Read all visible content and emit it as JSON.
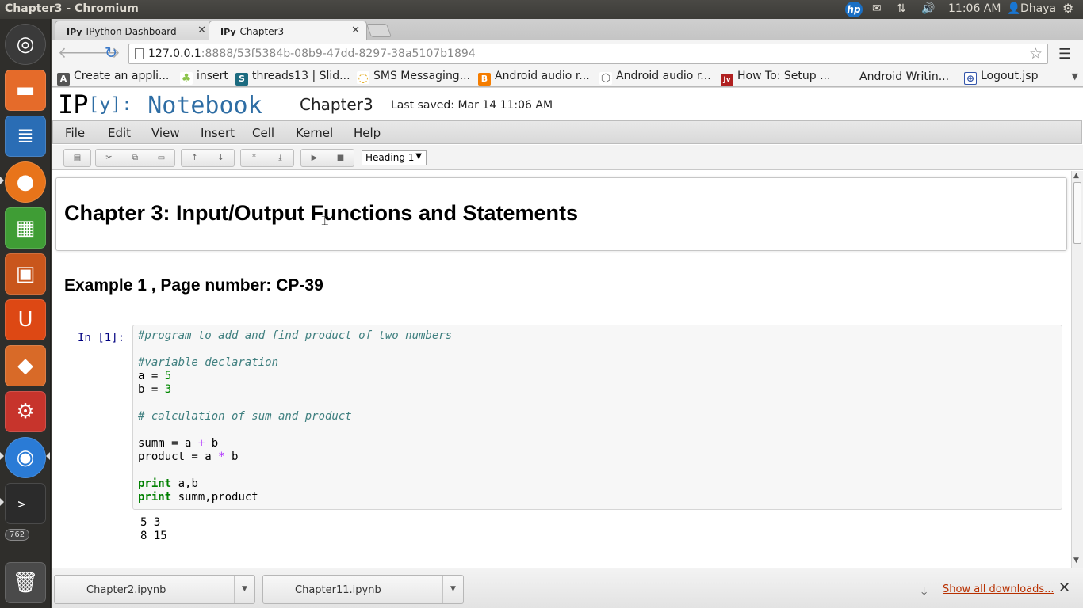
{
  "panel": {
    "window_title": "Chapter3 - Chromium",
    "time": "11:06 AM",
    "user": "Dhaya"
  },
  "launcher": {
    "badge": "762"
  },
  "tabs": [
    {
      "favicon": "IPy",
      "label": "IPython Dashboard"
    },
    {
      "favicon": "IPy",
      "label": "Chapter3"
    }
  ],
  "address": {
    "host": "127.0.0.1",
    "rest": ":8888/53f5384b-08b9-47dd-8297-38a5107b1894"
  },
  "bookmarks": [
    {
      "label": "Create an appli...",
      "color": "#555555",
      "icon": "A"
    },
    {
      "label": "insert",
      "color": "#8bc34a",
      "icon": "♣"
    },
    {
      "label": "threads13 | Slid...",
      "color": "#1c6b80",
      "icon": "S"
    },
    {
      "label": "SMS Messaging...",
      "color": "#e0a000",
      "icon": "◌"
    },
    {
      "label": "Android audio r...",
      "color": "#f57d00",
      "icon": "B"
    },
    {
      "label": "Android audio r...",
      "color": "#777777",
      "icon": "⬡"
    },
    {
      "label": "How To: Setup ...",
      "color": "#b02020",
      "icon": "Jv"
    },
    {
      "label": "Android Writin...",
      "color": "#ffffff",
      "icon": ""
    },
    {
      "label": "Logout.jsp",
      "color": "#3355aa",
      "icon": "⊕"
    }
  ],
  "ipython": {
    "logo_ip": "IP",
    "logo_y": "[y]:",
    "logo_notebook": "Notebook",
    "notebook_name": "Chapter3",
    "last_saved": "Last saved: Mar 14 11:06 AM",
    "menus": [
      "File",
      "Edit",
      "View",
      "Insert",
      "Cell",
      "Kernel",
      "Help"
    ],
    "cell_type": "Heading 1"
  },
  "cells": {
    "heading1": "Chapter 3: Input/Output Functions and Statements",
    "heading2": "Example 1 , Page number: CP-39",
    "prompt": "In [1]:",
    "code": {
      "l1": "#program to add and find product of two numbers",
      "l3": "#variable declaration",
      "l4a": "a = ",
      "l4b": "5",
      "l5a": "b = ",
      "l5b": "3",
      "l7": "# calculation of sum and product",
      "l9a": "summ = a ",
      "l9b": "+",
      "l9c": " b",
      "l10a": "product = a ",
      "l10b": "*",
      "l10c": " b",
      "kw_print": "print",
      "l12b": " a,b",
      "l13b": " summ,product"
    },
    "output": [
      "5 3",
      "8 15"
    ]
  },
  "downloads": {
    "items": [
      "Chapter2.ipynb",
      "Chapter11.ipynb"
    ],
    "show_all": "Show all downloads..."
  }
}
